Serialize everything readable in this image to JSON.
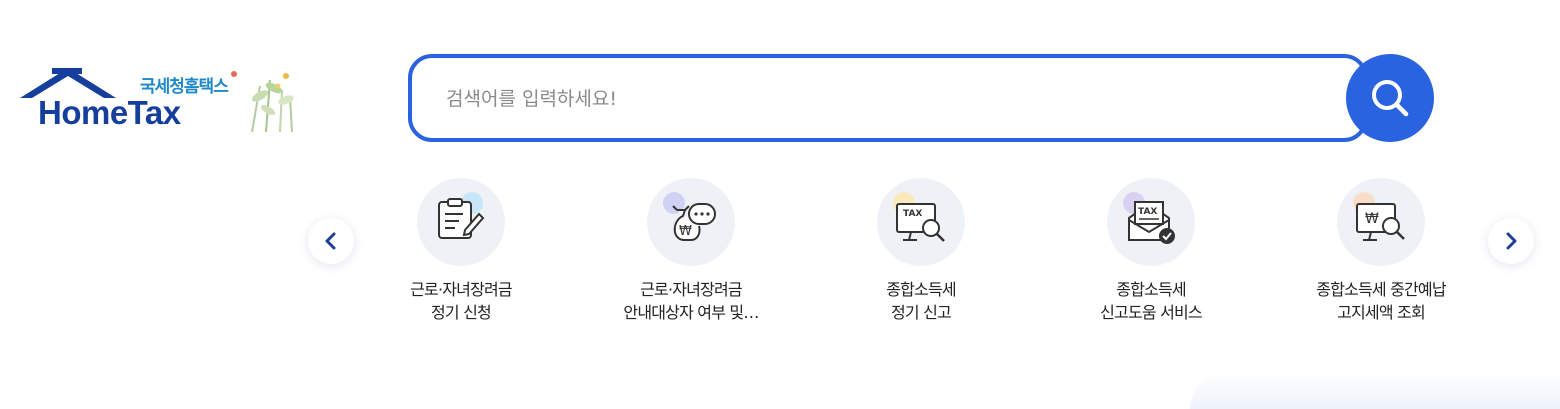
{
  "logo": {
    "subtitle": "국세청홈택스",
    "title": "HomeTax"
  },
  "search": {
    "placeholder": "검색어를 입력하세요!",
    "button_icon": "search-icon"
  },
  "carousel": {
    "prev_icon": "chevron-left-icon",
    "next_icon": "chevron-right-icon",
    "items": [
      {
        "line1": "근로·자녀장려금",
        "line2": "정기 신청",
        "icon": "clipboard-pen-icon",
        "dot_color": "#bfe4f7"
      },
      {
        "line1": "근로·자녀장려금",
        "line2": "안내대상자 여부 및…",
        "icon": "money-bag-chat-icon",
        "dot_color": "#c9cdf3"
      },
      {
        "line1": "종합소득세",
        "line2": "정기 신고",
        "icon": "tax-monitor-search-icon",
        "dot_color": "#fbe7b1"
      },
      {
        "line1": "종합소득세",
        "line2": "신고도움 서비스",
        "icon": "tax-envelope-check-icon",
        "dot_color": "#d4cbf1"
      },
      {
        "line1": "종합소득세 중간예납",
        "line2": "고지세액 조회",
        "icon": "won-monitor-search-icon",
        "dot_color": "#fbd9c1"
      }
    ]
  },
  "colors": {
    "accent": "#2a63e0",
    "logo_navy": "#163e9c",
    "logo_sub": "#1e88c8",
    "icon_bg": "#eef1f6"
  }
}
